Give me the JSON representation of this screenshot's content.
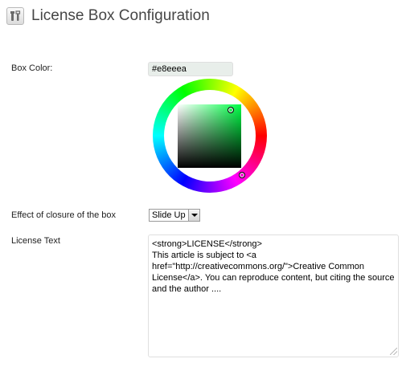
{
  "header": {
    "title": "License Box Configuration",
    "icon": "tools-icon"
  },
  "fields": {
    "box_color": {
      "label": "Box Color:",
      "value": "#e8eeea"
    },
    "color_picker": {
      "selected_color": "#e8eeea",
      "hue": "green"
    },
    "closure_effect": {
      "label": "Effect of closure of the box",
      "selected": "Slide Up"
    },
    "license_text": {
      "label": "License Text",
      "value": "<strong>LICENSE</strong>\nThis article is subject to <a href=\"http://creativecommons.org/\">Creative Common License</a>. You can reproduce content, but citing the source and the author ...."
    }
  }
}
